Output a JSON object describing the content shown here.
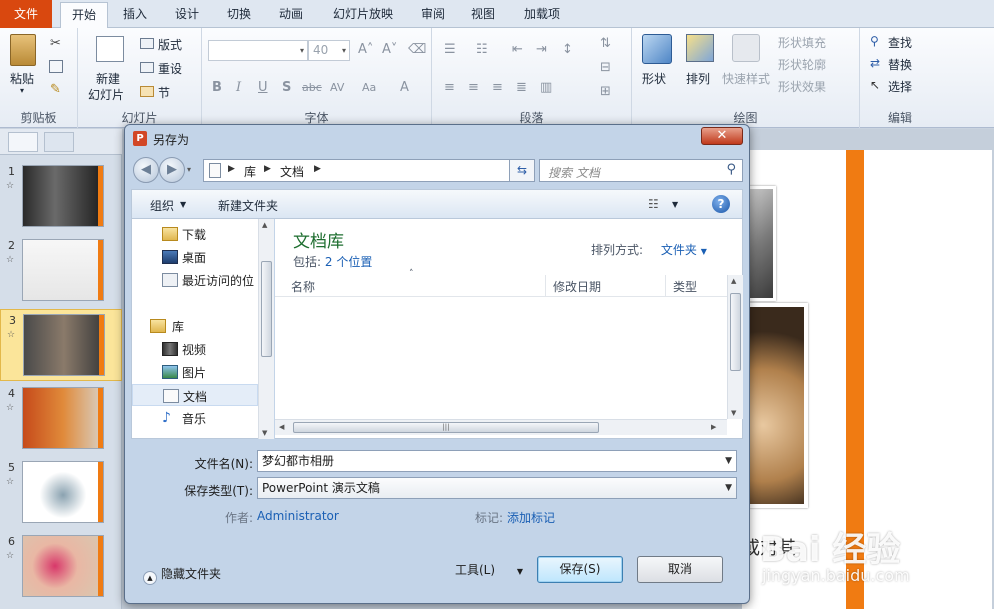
{
  "ribbon": {
    "tabs": [
      "文件",
      "开始",
      "插入",
      "设计",
      "切换",
      "动画",
      "幻灯片放映",
      "审阅",
      "视图",
      "加载项"
    ],
    "clipboard": {
      "paste": "粘贴",
      "label": "剪贴板"
    },
    "slides": {
      "new_slide": "新建",
      "new_slide2": "幻灯片",
      "layout": "版式",
      "reset": "重设",
      "section": "节",
      "label": "幻灯片"
    },
    "font": {
      "size": "40",
      "label": "字体"
    },
    "paragraph": {
      "label": "段落"
    },
    "drawing": {
      "shape": "形状",
      "arrange": "排列",
      "quick_styles": "快速样式",
      "fill": "形状填充",
      "outline": "形状轮廓",
      "effects": "形状效果",
      "label": "绘图"
    },
    "editing": {
      "find": "查找",
      "replace": "替换",
      "select": "选择",
      "label": "编辑"
    }
  },
  "slides_panel": {
    "numbers": [
      "1",
      "2",
      "3",
      "4",
      "5",
      "6"
    ]
  },
  "slide": {
    "caption": "或对其"
  },
  "watermark": {
    "brand": "Bai 经验",
    "url": "jingyan.baidu.com"
  },
  "dialog": {
    "title": "另存为",
    "close": "✕",
    "address": {
      "crumbs": [
        "库",
        "文档"
      ]
    },
    "search_placeholder": "搜索 文档",
    "commands": {
      "organize": "组织",
      "new_folder": "新建文件夹"
    },
    "nav": {
      "items": [
        "下载",
        "桌面",
        "最近访问的位"
      ],
      "library": "库",
      "lib_items": [
        "视频",
        "图片",
        "文档",
        "音乐"
      ]
    },
    "content": {
      "title": "文档库",
      "includes_label": "包括:",
      "includes_link": "2 个位置",
      "arrange_label": "排列方式:",
      "arrange_value": "文件夹",
      "columns": [
        "名称",
        "修改日期",
        "类型"
      ]
    },
    "filename_label": "文件名(N):",
    "filename_value": "梦幻都市相册",
    "filetype_label": "保存类型(T):",
    "filetype_value": "PowerPoint 演示文稿",
    "author_label": "作者:",
    "author_value": "Administrator",
    "tags_label": "标记:",
    "tags_value": "添加标记",
    "hide_folders": "隐藏文件夹",
    "tools": "工具(L)",
    "save": "保存(S)",
    "cancel": "取消"
  }
}
